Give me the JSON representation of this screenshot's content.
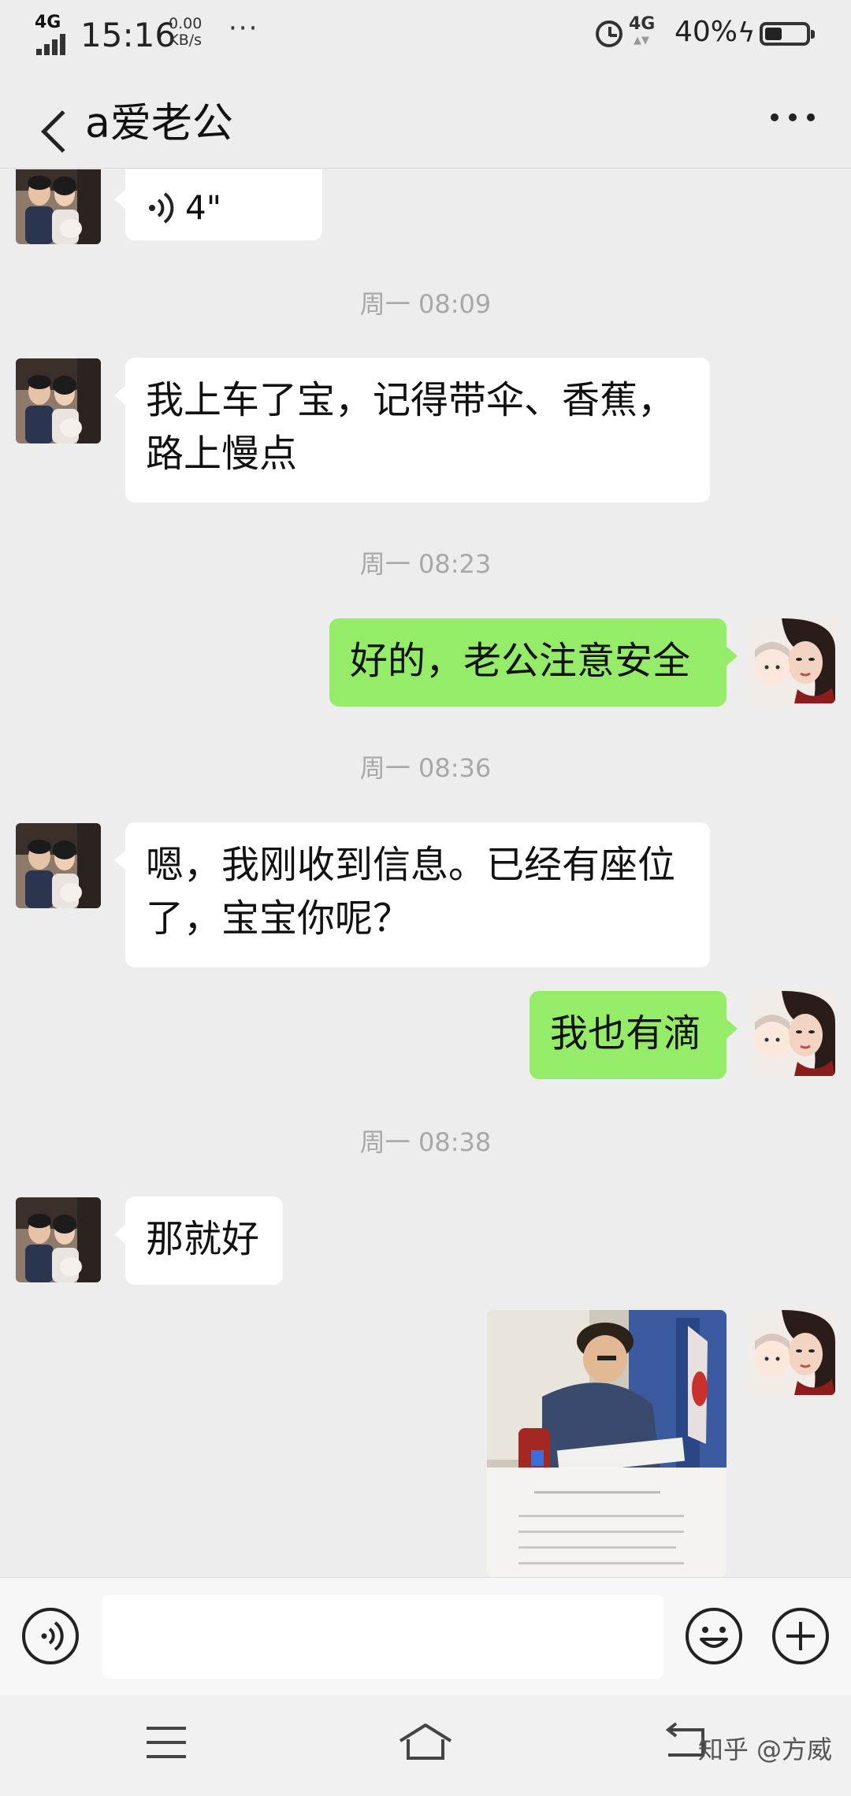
{
  "status_bar": {
    "network_left": "4G",
    "time": "15:16",
    "speed_value": "0.00",
    "speed_unit": "KB/s",
    "more": "···",
    "network_right": "4G",
    "battery_pct": "40%",
    "battery_level": 0.4
  },
  "header": {
    "title": "a爱老公"
  },
  "messages": {
    "voice": {
      "duration": "4\""
    },
    "ts1": "周一 08:09",
    "msg1_line1": "我上车了宝，记得带伞、香蕉，",
    "msg1_line2": "路上慢点",
    "ts2": "周一 08:23",
    "msg2": "好的，老公注意安全",
    "ts3": "周一 08:36",
    "msg3_line1": "嗯，我刚收到信息。已经有座位",
    "msg3_line2": "了，宝宝你呢？",
    "msg4": "我也有滴",
    "ts4": "周一 08:38",
    "msg5": "那就好"
  },
  "input": {
    "placeholder": ""
  },
  "watermark": "知乎 @方威",
  "colors": {
    "background": "#ededed",
    "incoming_bubble": "#ffffff",
    "outgoing_bubble": "#95ec69",
    "timestamp": "#a8a8a8"
  },
  "icons": {
    "back": "back-icon",
    "more": "more-icon",
    "voice_msg": "voice-wave-icon",
    "voice_input": "voice-input-icon",
    "emoji": "emoji-icon",
    "plus": "plus-icon",
    "nav_menu": "menu-icon",
    "nav_home": "home-icon",
    "nav_back": "back-nav-icon"
  }
}
